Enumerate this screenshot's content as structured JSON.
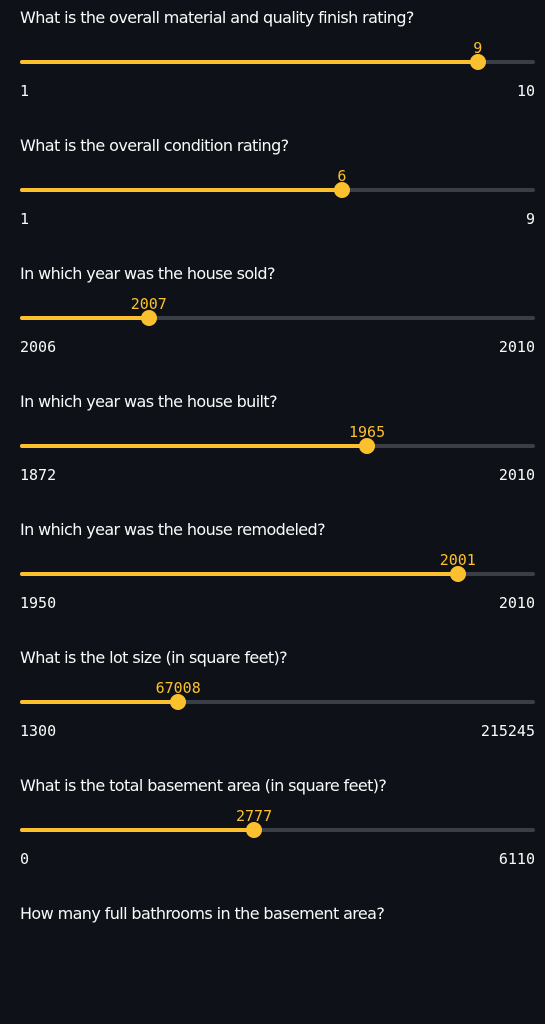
{
  "theme": {
    "background": "#0e1117",
    "accent": "#fbc02d",
    "track": "#3a3e47",
    "text": "#fafafa"
  },
  "sliders": [
    {
      "question": "What is the overall material and quality finish rating?",
      "value": "9",
      "min": "1",
      "max": "10"
    },
    {
      "question": "What is the overall condition rating?",
      "value": "6",
      "min": "1",
      "max": "9"
    },
    {
      "question": "In which year was the house sold?",
      "value": "2007",
      "min": "2006",
      "max": "2010"
    },
    {
      "question": "In which year was the house built?",
      "value": "1965",
      "min": "1872",
      "max": "2010"
    },
    {
      "question": "In which year was the house remodeled?",
      "value": "2001",
      "min": "1950",
      "max": "2010"
    },
    {
      "question": "What is the lot size (in square feet)?",
      "value": "67008",
      "min": "1300",
      "max": "215245"
    },
    {
      "question": "What is the total basement area (in square feet)?",
      "value": "2777",
      "min": "0",
      "max": "6110"
    },
    {
      "question": "How many full bathrooms in the basement area?"
    }
  ]
}
